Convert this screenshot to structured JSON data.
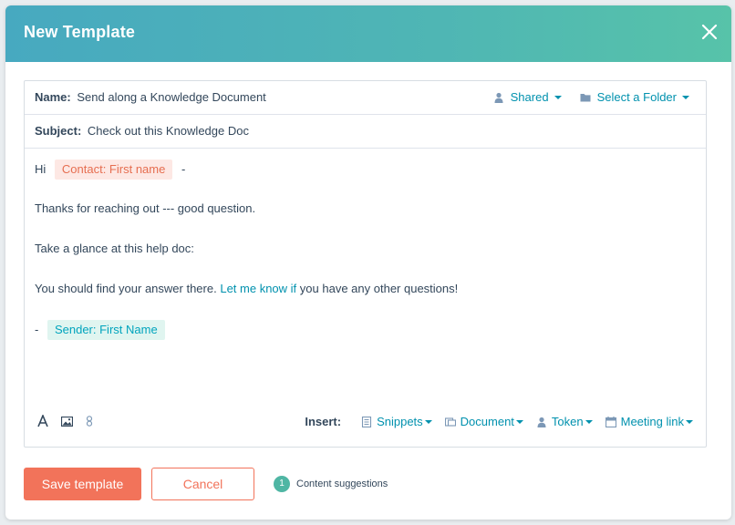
{
  "modal": {
    "title": "New Template"
  },
  "name_row": {
    "label": "Name:",
    "value": "Send along a Knowledge Document",
    "shared_label": "Shared",
    "folder_label": "Select a Folder"
  },
  "subject_row": {
    "label": "Subject:",
    "value": "Check out this Knowledge Doc"
  },
  "body": {
    "greeting": "Hi",
    "contact_token": "Contact: First name",
    "greeting_suffix": "-",
    "line1": "Thanks for reaching out --- good question.",
    "line2": "Take a glance at this help doc:",
    "line3_pre": "You should find your answer there.",
    "line3_link": "Let me know if",
    "line3_post": "you have any other questions!",
    "signoff_prefix": "-",
    "sender_token": "Sender: First Name"
  },
  "toolbar": {
    "insert_label": "Insert:",
    "snippets": "Snippets",
    "document": "Document",
    "token": "Token",
    "meeting_link": "Meeting link"
  },
  "footer": {
    "save_label": "Save template",
    "cancel_label": "Cancel",
    "suggestion_count": "1",
    "suggestion_label": "Content suggestions"
  },
  "colors": {
    "header_gradient_start": "#47a9c0",
    "header_gradient_end": "#57c3a9",
    "link": "#0091ae",
    "primary_button": "#f2735a",
    "contact_token_bg": "#fde8e4",
    "contact_token_text": "#e66e50",
    "sender_token_bg": "#e0f5f0",
    "sender_token_text": "#00a4bd",
    "suggestion_badge": "#4fb6a4"
  },
  "icons": {
    "close": "close-icon",
    "shared": "person-icon",
    "folder": "folder-icon",
    "font": "font-icon",
    "image": "image-icon",
    "link": "link-icon",
    "snippets": "snippet-icon",
    "document": "document-icon",
    "token": "person-icon",
    "meeting": "calendar-icon"
  }
}
